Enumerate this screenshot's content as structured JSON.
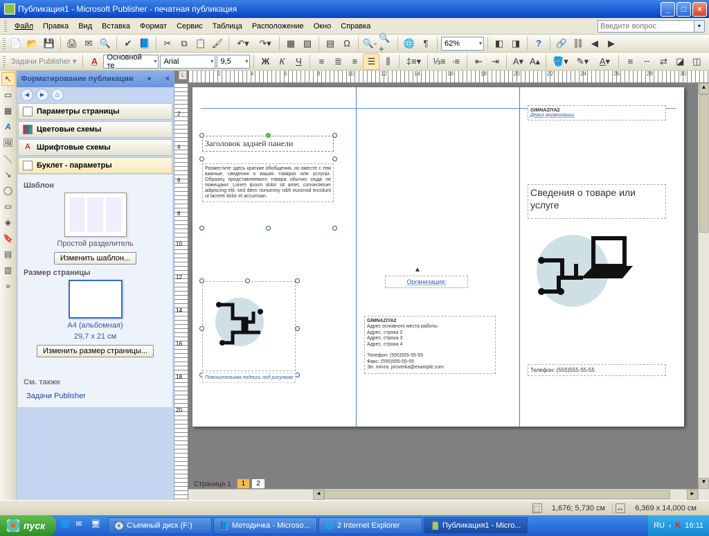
{
  "title": "Публикация1 - Microsoft Publisher - печатная публикация",
  "menu": [
    "Файл",
    "Правка",
    "Вид",
    "Вставка",
    "Формат",
    "Сервис",
    "Таблица",
    "Расположение",
    "Окно",
    "Справка"
  ],
  "help_placeholder": "Введите вопрос",
  "tasks_label": "Задачи Publisher",
  "font_style": "Основной те",
  "font_name": "Arial",
  "font_size": "9,5",
  "zoom": "62%",
  "taskpane": {
    "title": "Форматирование публикации",
    "acc1": "Параметры страницы",
    "acc2": "Цветовые схемы",
    "acc3": "Шрифтовые схемы",
    "acc4": "Буклет - параметры",
    "template_label": "Шаблон",
    "template_name": "Простой разделитель",
    "change_template": "Изменить шаблон...",
    "pagesize_label": "Размер страницы",
    "pagesize_name": "A4 (альбомная)",
    "pagesize_dim": "29,7 x 21 см",
    "change_pagesize": "Изменить размер страницы...",
    "see_also": "См. также",
    "see_also_link": "Задачи Publisher"
  },
  "doc": {
    "back_heading": "Заголовок задней панели",
    "back_body": "Разместите здесь краткие обобщения, но вместе с тем важные, сведения о ваших товарах или услугах. Образец представляемого товара обычно сюда не помещают.\nLorem ipsum dolor sit amet, consectetuer adipiscing elit, sed diem nonummy nibh euismod tincidunt ut lacreet dolor et accumsan.",
    "caption": "Пояснительная подпись под рисунком",
    "org_label": "Организация:",
    "gimn": "GIMNAZIYA2",
    "addr1": "Адрес основного места работы",
    "addr2": "Адрес, строка 2",
    "addr3": "Адрес, строка 3",
    "addr4": "Адрес, строка 4",
    "tel": "Телефон: (555)555-55-55",
    "fax": "Факс: (555)555-55-55",
    "email": "Эл. почта: proverka@example.com",
    "motto": "Девиз организации",
    "front_heading": "Сведения о товаре или услуге",
    "front_phone": "Телефон: (555)555-55-55"
  },
  "page_tab_label": "Страница 1",
  "page_tabs": [
    "1",
    "2"
  ],
  "status": {
    "pos": "1,676; 5,730 см",
    "size": "6,369 x 14,000 см"
  },
  "taskbar": {
    "start": "пуск",
    "btn1": "Съемный диск (F:)",
    "btn2": "Методичка - Microso...",
    "btn3": "2 Internet Explorer",
    "btn4": "Публикация1 - Micro...",
    "lang": "RU",
    "time": "16:11"
  }
}
